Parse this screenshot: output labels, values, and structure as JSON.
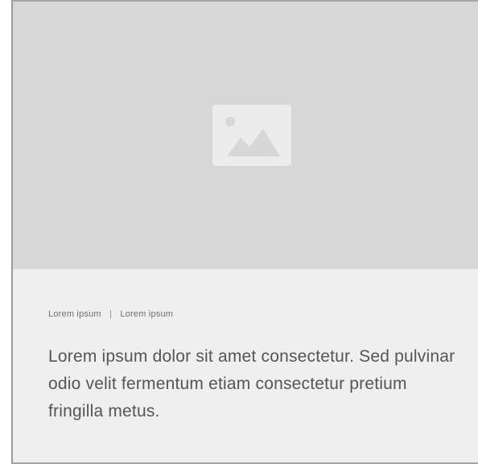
{
  "card": {
    "image_icon": "image-placeholder-icon",
    "meta": {
      "first": "Lorem ipsum",
      "separator": "|",
      "second": "Lorem ipsum"
    },
    "description": "Lorem ipsum dolor sit amet consectetur. Sed pulvinar odio velit fermentum etiam consectetur pretium fringilla metus."
  },
  "colors": {
    "page_background": "#ffffff",
    "image_area": "#d7d7d7",
    "content_area": "#efefef",
    "icon": "#ececec",
    "text": "#555555"
  }
}
